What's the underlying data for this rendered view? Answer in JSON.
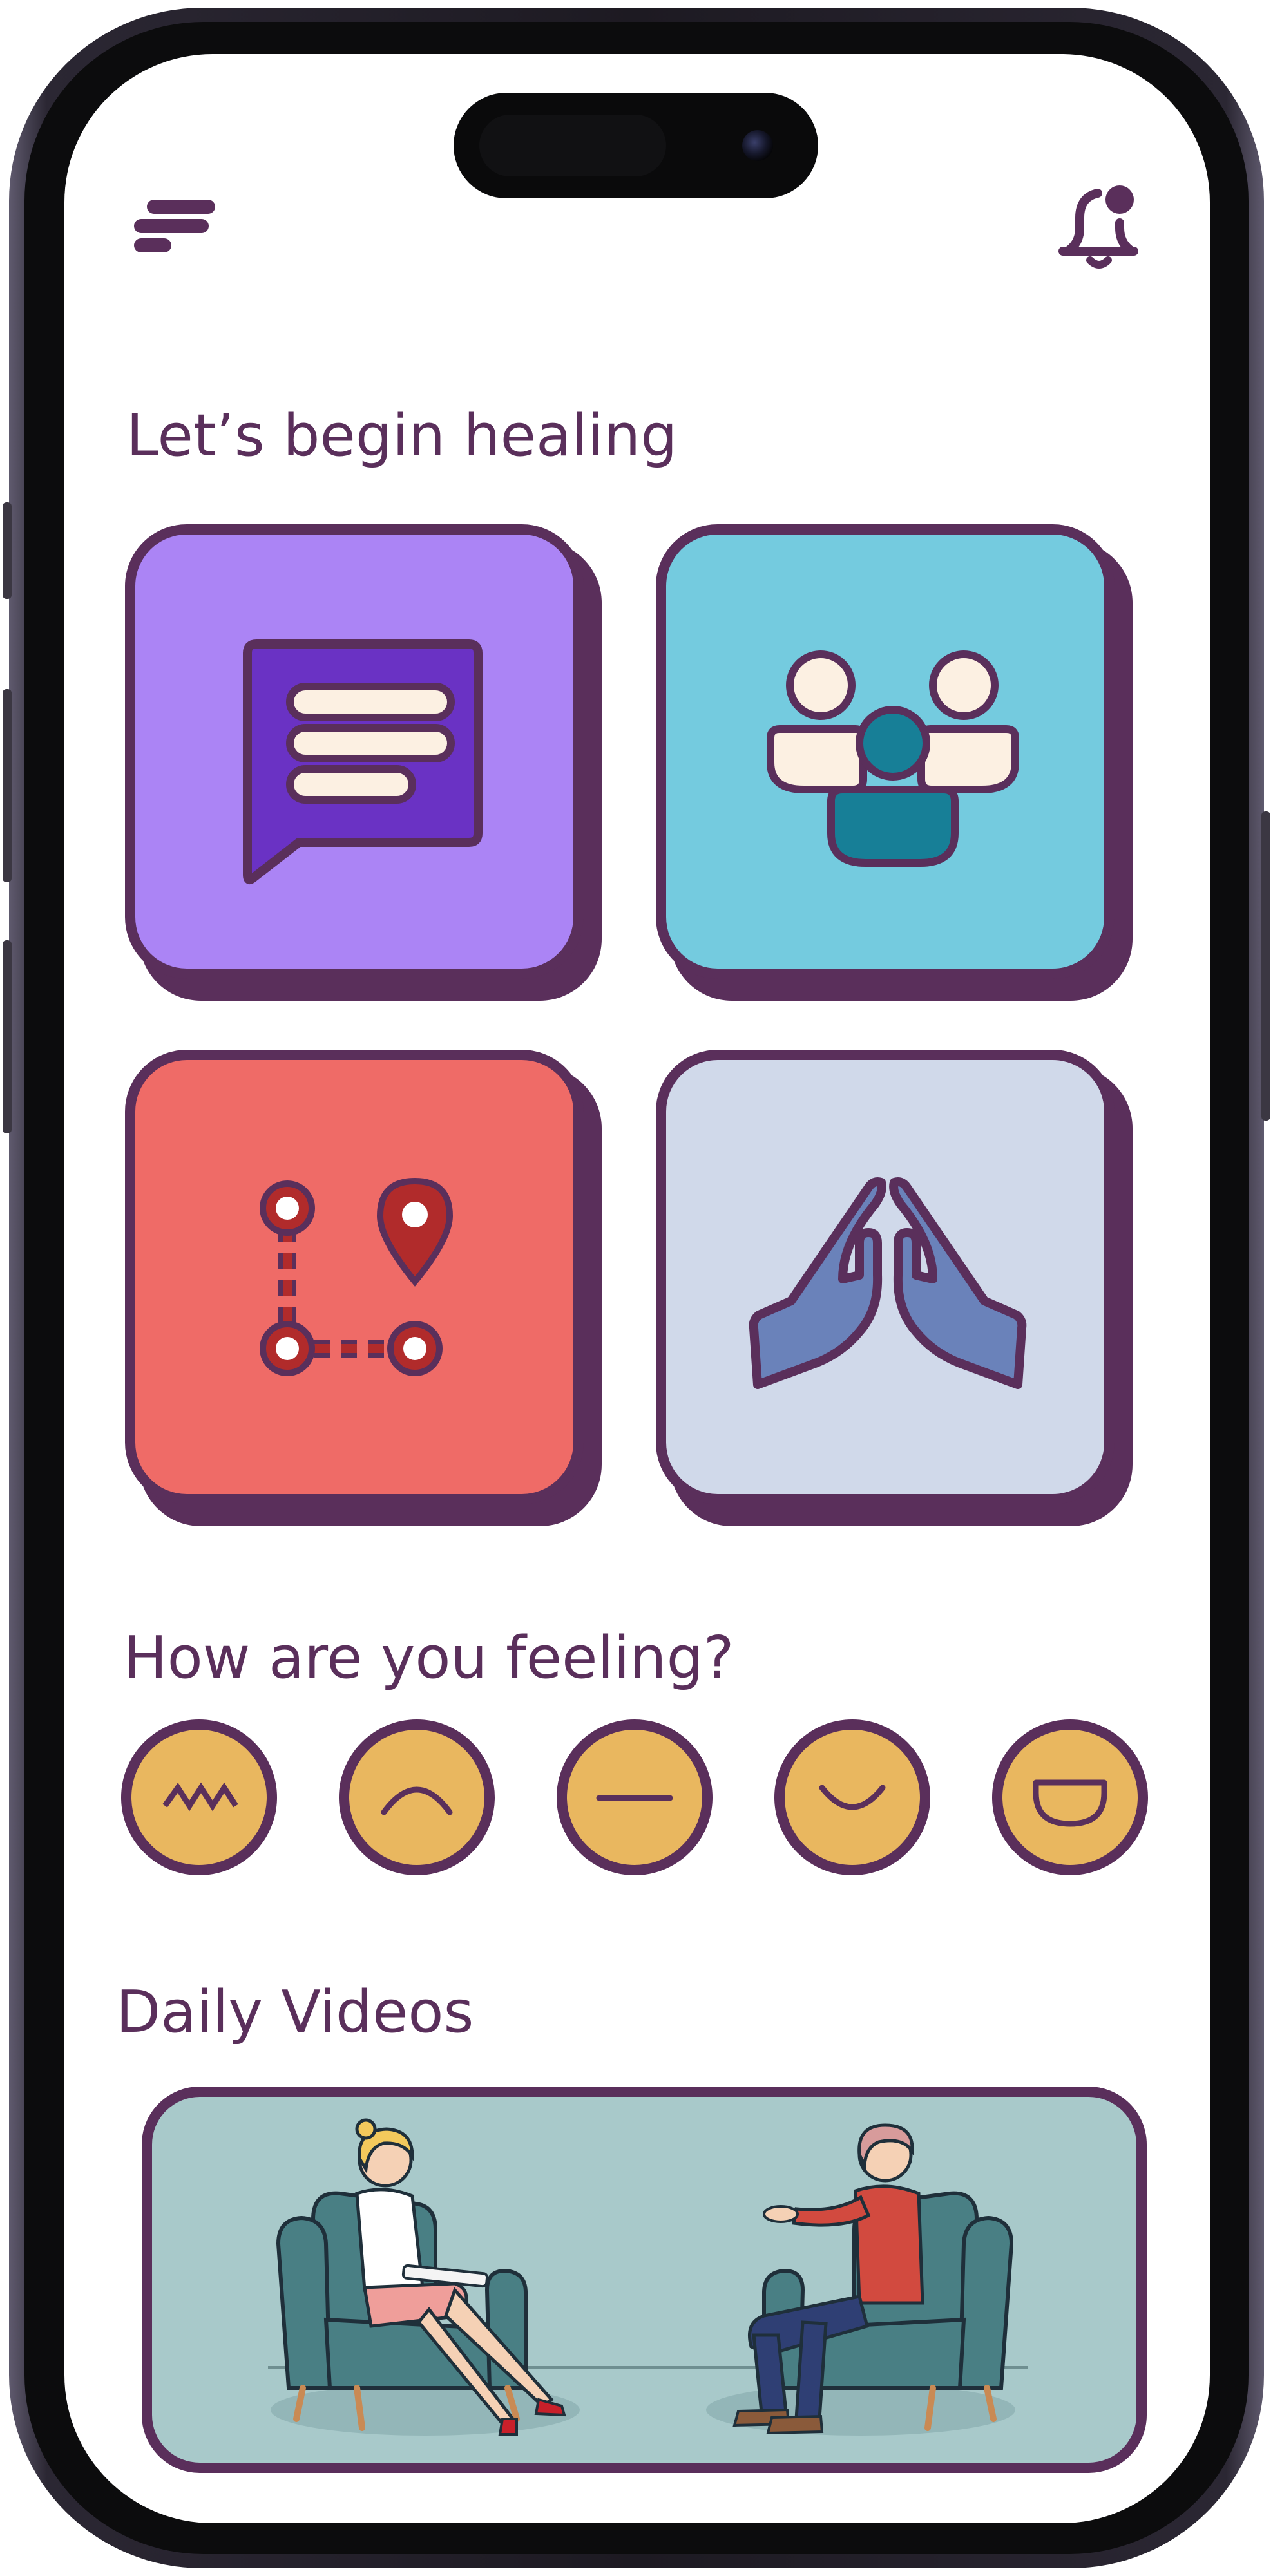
{
  "header": {
    "menu_icon": "menu-lines-icon",
    "notification_icon": "bell-notification-icon"
  },
  "healing": {
    "title": "Let’s begin healing",
    "tiles": [
      {
        "icon": "chat-message-icon",
        "color": "#ab84f5"
      },
      {
        "icon": "group-community-icon",
        "color": "#74cbdf"
      },
      {
        "icon": "route-journey-icon",
        "color": "#ef6b67"
      },
      {
        "icon": "praying-hands-icon",
        "color": "#d0d9ea"
      }
    ]
  },
  "feeling": {
    "title": "How are you feeling?",
    "moods": [
      {
        "icon": "zigzag-mood-icon"
      },
      {
        "icon": "sad-mood-icon"
      },
      {
        "icon": "neutral-mood-icon"
      },
      {
        "icon": "happy-mood-icon"
      },
      {
        "icon": "very-happy-mood-icon"
      }
    ],
    "mood_color": "#e9b75f"
  },
  "videos": {
    "title": "Daily Videos",
    "thumbnail": "therapy-session-illustration"
  },
  "colors": {
    "accent": "#5a2f5b",
    "background": "#ffffff"
  }
}
